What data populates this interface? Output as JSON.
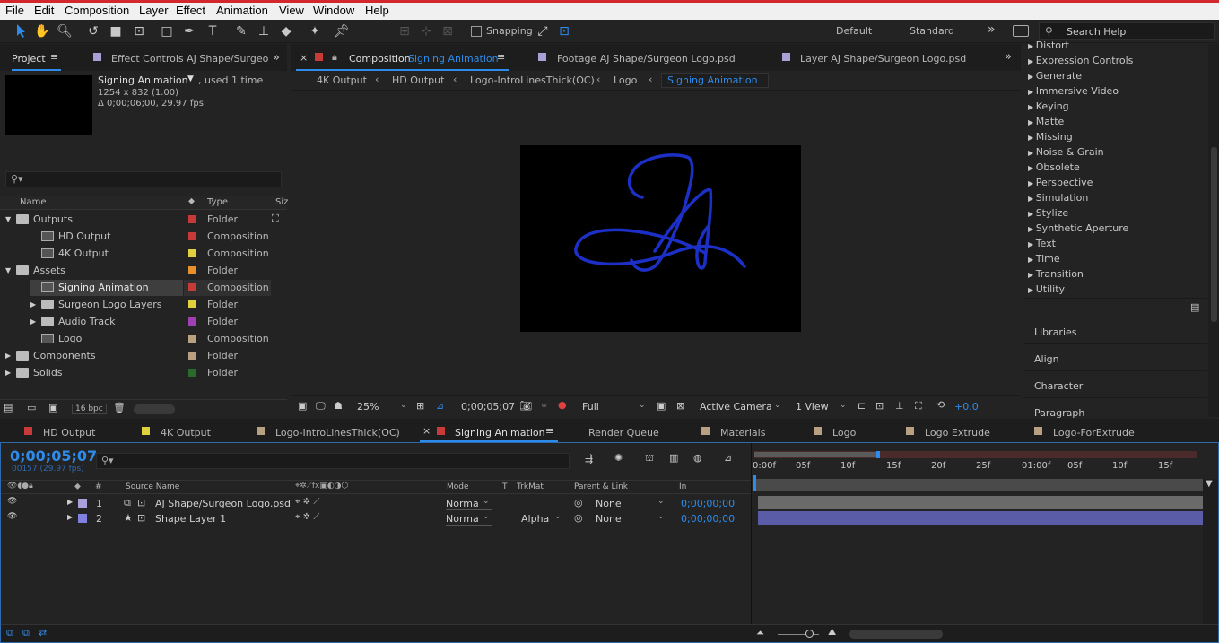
{
  "menu": [
    "File",
    "Edit",
    "Composition",
    "Layer",
    "Effect",
    "Animation",
    "View",
    "Window",
    "Help"
  ],
  "toolbar": {
    "snapping": "Snapping",
    "workspaces": [
      "Default",
      "Standard"
    ],
    "search_placeholder": "Search Help"
  },
  "project": {
    "tab": "Project",
    "effect_tab": "Effect Controls AJ Shape/Surgeo",
    "comp_name": "Signing Animation",
    "used": ", used 1 time",
    "dims": "1254 x 832 (1.00)",
    "duration": "Δ 0;00;06;00, 29.97 fps",
    "columns": {
      "name": "Name",
      "type": "Type",
      "size": "Siz"
    },
    "items": [
      {
        "name": "Outputs",
        "type": "Folder",
        "color": "#c83a3a",
        "indent": 0,
        "folder": true,
        "open": true
      },
      {
        "name": "HD Output",
        "type": "Composition",
        "color": "#c83a3a",
        "indent": 1,
        "folder": false
      },
      {
        "name": "4K Output",
        "type": "Composition",
        "color": "#e0d040",
        "indent": 1,
        "folder": false
      },
      {
        "name": "Assets",
        "type": "Folder",
        "color": "#e8902a",
        "indent": 0,
        "folder": true,
        "open": true
      },
      {
        "name": "Signing Animation",
        "type": "Composition",
        "color": "#c83a3a",
        "indent": 1,
        "folder": false,
        "selected": true
      },
      {
        "name": "Surgeon Logo Layers",
        "type": "Folder",
        "color": "#e0d040",
        "indent": 1,
        "folder": true
      },
      {
        "name": "Audio Track",
        "type": "Folder",
        "color": "#a040b0",
        "indent": 1,
        "folder": true
      },
      {
        "name": "Logo",
        "type": "Composition",
        "color": "#b8a080",
        "indent": 1,
        "folder": false
      },
      {
        "name": "Components",
        "type": "Folder",
        "color": "#b8a080",
        "indent": 0,
        "folder": true
      },
      {
        "name": "Solids",
        "type": "Folder",
        "color": "#2a6a2a",
        "indent": 0,
        "folder": true
      }
    ],
    "bpc": "16 bpc"
  },
  "viewer": {
    "tabs": {
      "comp_prefix": "Composition",
      "comp_name": "Signing Animation",
      "footage": "Footage AJ Shape/Surgeon Logo.psd",
      "layer": "Layer AJ Shape/Surgeon Logo.psd"
    },
    "breadcrumbs": [
      "4K Output",
      "HD Output",
      "Logo-IntroLinesThick(OC)",
      "Logo",
      "Signing Animation"
    ],
    "zoom": "25%",
    "timecode": "0;00;05;07",
    "resolution": "Full",
    "camera": "Active Camera",
    "views": "1 View",
    "exposure": "+0.0"
  },
  "effects": {
    "items": [
      "Distort",
      "Expression Controls",
      "Generate",
      "Immersive Video",
      "Keying",
      "Matte",
      "Missing",
      "Noise & Grain",
      "Obsolete",
      "Perspective",
      "Simulation",
      "Stylize",
      "Synthetic Aperture",
      "Text",
      "Time",
      "Transition",
      "Utility"
    ],
    "panels": [
      "Libraries",
      "Align",
      "Character",
      "Paragraph"
    ]
  },
  "timeline": {
    "tabs": [
      {
        "name": "HD Output",
        "color": "#c83a3a"
      },
      {
        "name": "4K Output",
        "color": "#e0d040"
      },
      {
        "name": "Logo-IntroLinesThick(OC)",
        "color": "#b8a080"
      },
      {
        "name": "Signing Animation",
        "color": "#c83a3a",
        "active": true
      },
      {
        "name": "Render Queue",
        "color": ""
      },
      {
        "name": "Materials",
        "color": "#b8a080"
      },
      {
        "name": "Logo",
        "color": "#b8a080"
      },
      {
        "name": "Logo Extrude",
        "color": "#b8a080"
      },
      {
        "name": "Logo-ForExtrude",
        "color": "#b8a080"
      }
    ],
    "timecode": "0;00;05;07",
    "fps": "00157 (29.97 fps)",
    "cols": {
      "num": "#",
      "source": "Source Name",
      "mode": "Mode",
      "t": "T",
      "trkmat": "TrkMat",
      "parent": "Parent & Link",
      "in": "In"
    },
    "layers": [
      {
        "num": "1",
        "name": "AJ Shape/Surgeon Logo.psd",
        "mode": "Norma",
        "trkmat": "",
        "parent": "None",
        "in": "0;00;00;00",
        "color": "#a8a0d8"
      },
      {
        "num": "2",
        "name": "Shape Layer 1",
        "mode": "Norma",
        "trkmat": "Alpha",
        "parent": "None",
        "in": "0;00;00;00",
        "color": "#8080e0"
      }
    ],
    "ruler": [
      "0:00f",
      "05f",
      "10f",
      "15f",
      "20f",
      "25f",
      "01:00f",
      "05f",
      "10f",
      "15f"
    ]
  }
}
